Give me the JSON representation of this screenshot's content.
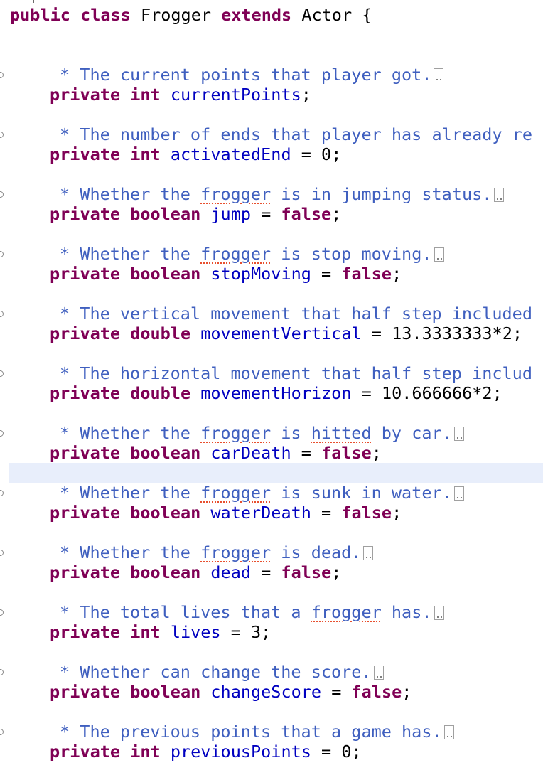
{
  "class_decl": {
    "kw_public": "public",
    "kw_class": "class",
    "name": "Frogger",
    "kw_extends": "extends",
    "parent": "Actor",
    "brace": "{"
  },
  "fields": [
    {
      "comment_pre": "* The current points that player got.",
      "comment_spell": "",
      "comment_post": "",
      "kw1": "private",
      "type": "int",
      "name": "currentPoints",
      "eq": "",
      "value": "",
      "value_kw": "",
      "semi": ";",
      "folded": true
    },
    {
      "comment_pre": "* The number of ends that player has already re",
      "comment_spell": "",
      "comment_post": "",
      "kw1": "private",
      "type": "int",
      "name": "activatedEnd",
      "eq": " = ",
      "value": "0",
      "value_kw": "",
      "semi": ";",
      "folded": false
    },
    {
      "comment_pre": "* Whether the ",
      "comment_spell": "frogger",
      "comment_post": " is in jumping status.",
      "kw1": "private",
      "type": "boolean",
      "name": "jump",
      "eq": " = ",
      "value": "",
      "value_kw": "false",
      "semi": ";",
      "folded": true
    },
    {
      "comment_pre": "* Whether the ",
      "comment_spell": "frogger",
      "comment_post": " is stop moving.",
      "kw1": "private",
      "type": "boolean",
      "name": "stopMoving",
      "eq": " = ",
      "value": "",
      "value_kw": "false",
      "semi": ";",
      "folded": true
    },
    {
      "comment_pre": "* The vertical movement that half step included",
      "comment_spell": "",
      "comment_post": "",
      "kw1": "private",
      "type": "double",
      "name": "movementVertical",
      "eq": " = ",
      "value": "13.3333333*2",
      "value_kw": "",
      "semi": ";",
      "folded": false
    },
    {
      "comment_pre": "* The horizontal movement that half step includ",
      "comment_spell": "",
      "comment_post": "",
      "kw1": "private",
      "type": "double",
      "name": "movementHorizon",
      "eq": " = ",
      "value": "10.666666*2",
      "value_kw": "",
      "semi": ";",
      "folded": false
    },
    {
      "comment_pre": "* Whether the ",
      "comment_spell": "frogger",
      "comment_post": " is ",
      "comment_spell2": "hitted",
      "comment_post2": " by car.",
      "kw1": "private",
      "type": "boolean",
      "name": "carDeath",
      "eq": " = ",
      "value": "",
      "value_kw": "false",
      "semi": ";",
      "folded": true
    },
    {
      "comment_pre": "* Whether the ",
      "comment_spell": "frogger",
      "comment_post": " is sunk in water.",
      "kw1": "private",
      "type": "boolean",
      "name": "waterDeath",
      "eq": " = ",
      "value": "",
      "value_kw": "false",
      "semi": ";",
      "folded": true
    },
    {
      "comment_pre": "* Whether the ",
      "comment_spell": "frogger",
      "comment_post": " is dead.",
      "kw1": "private",
      "type": "boolean",
      "name": "dead",
      "eq": " = ",
      "value": "",
      "value_kw": "false",
      "semi": ";",
      "folded": true
    },
    {
      "comment_pre": "* The total lives that a ",
      "comment_spell": "frogger",
      "comment_post": " has.",
      "kw1": "private",
      "type": "int",
      "name": "lives",
      "eq": " = ",
      "value": "3",
      "value_kw": "",
      "semi": ";",
      "folded": true
    },
    {
      "comment_pre": "* Whether can change the score.",
      "comment_spell": "",
      "comment_post": "",
      "kw1": "private",
      "type": "boolean",
      "name": "changeScore",
      "eq": " = ",
      "value": "",
      "value_kw": "false",
      "semi": ";",
      "folded": true
    },
    {
      "comment_pre": "* The previous points that a game has.",
      "comment_spell": "",
      "comment_post": "",
      "kw1": "private",
      "type": "int",
      "name": "previousPoints",
      "eq": " = ",
      "value": "0",
      "value_kw": "",
      "semi": ";",
      "folded": true
    }
  ]
}
